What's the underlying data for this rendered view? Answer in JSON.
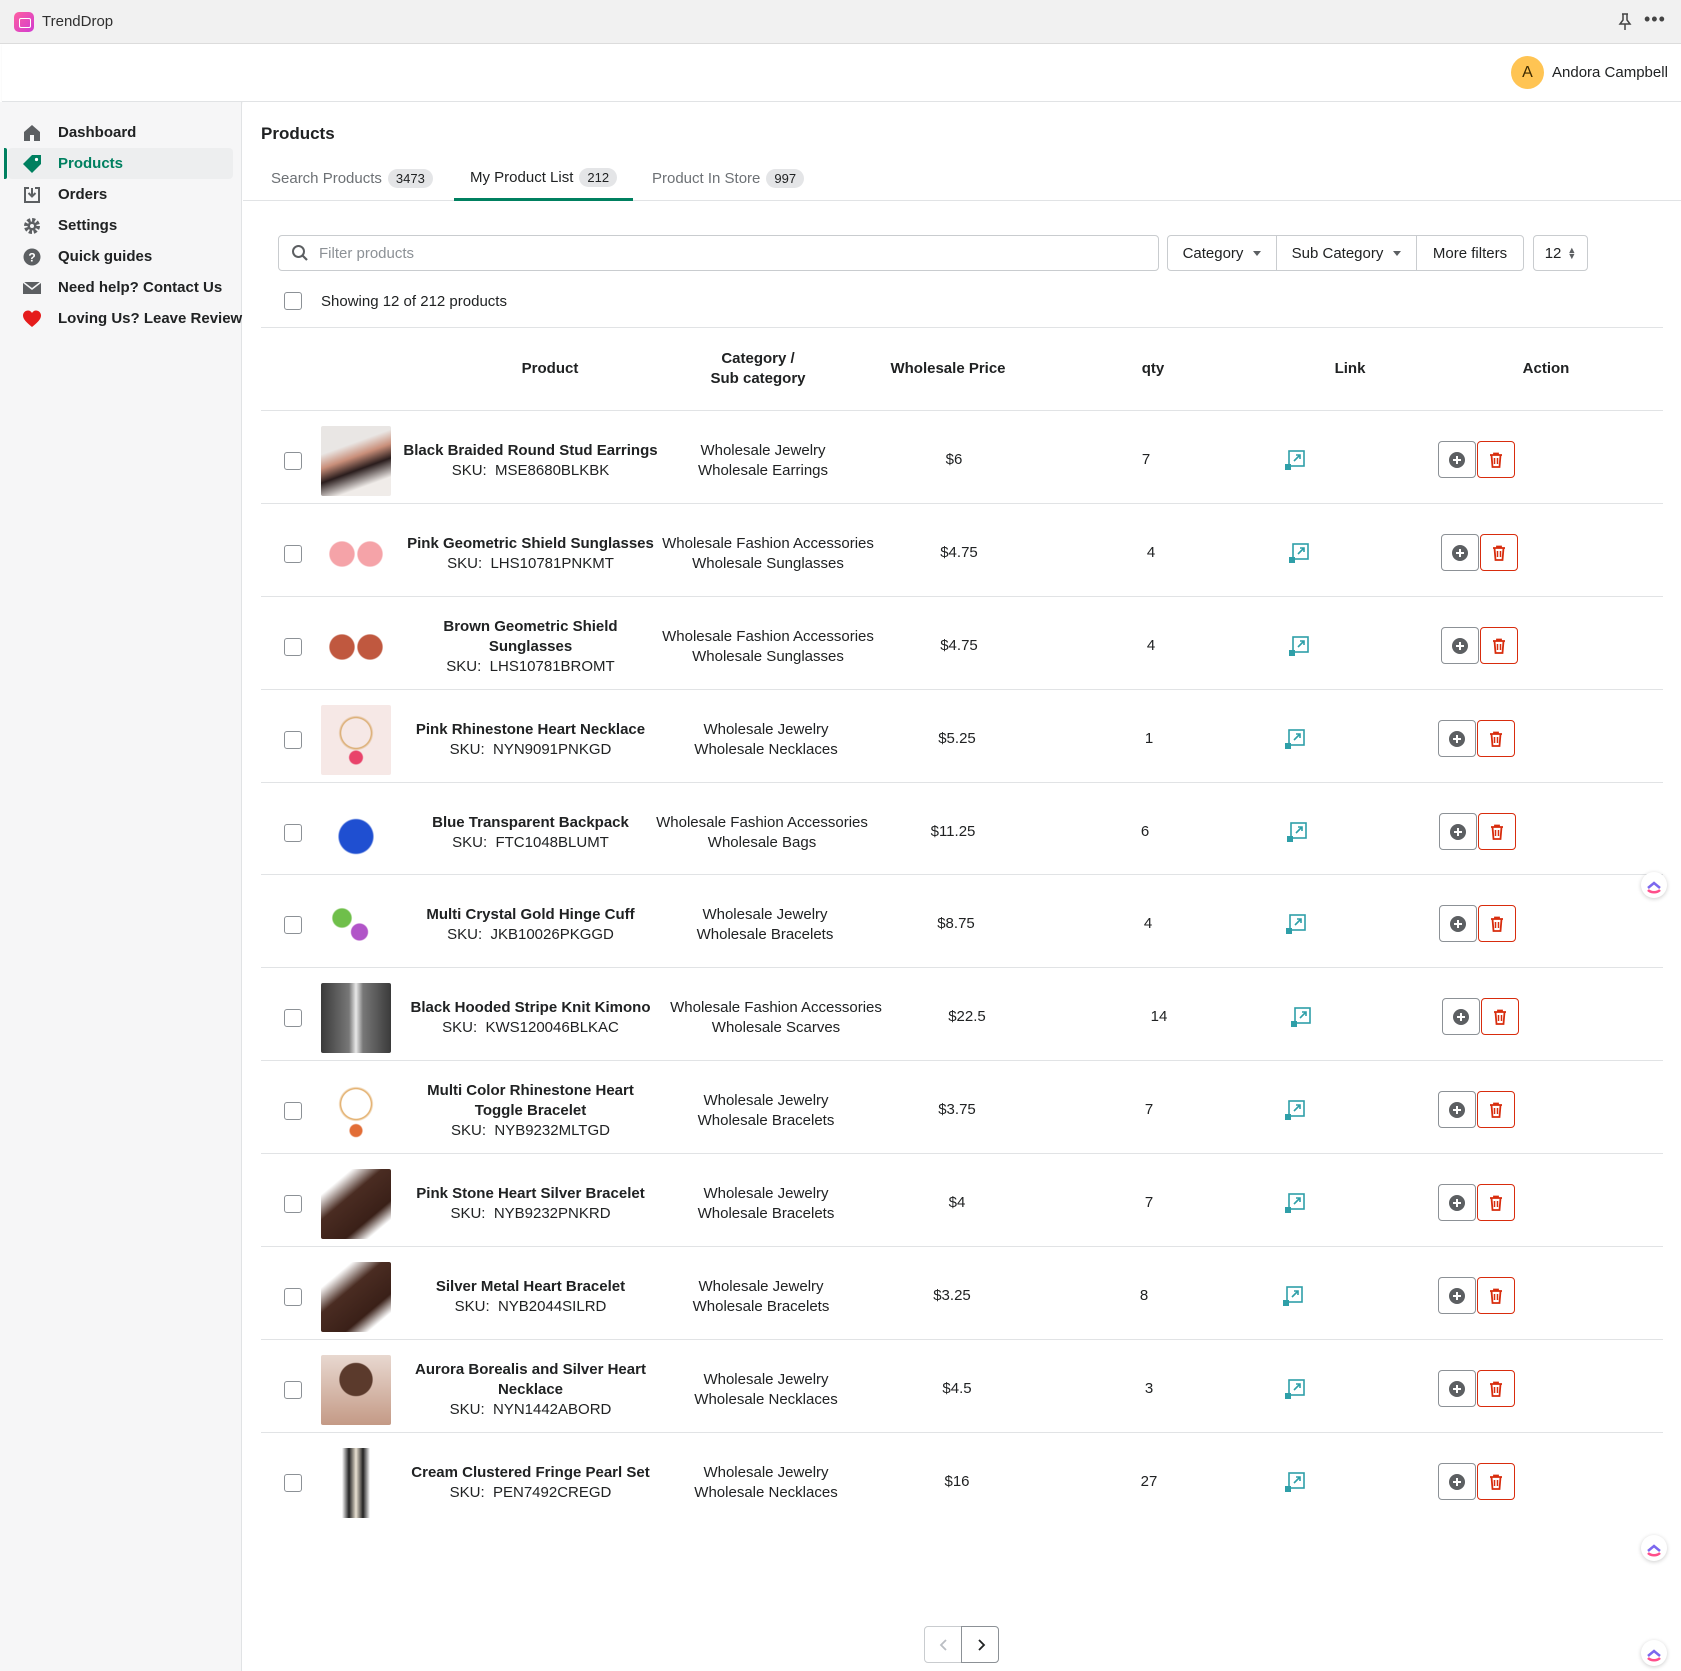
{
  "app": {
    "title": "TrendDrop"
  },
  "user": {
    "initial": "A",
    "name": "Andora Campbell"
  },
  "sidebar": {
    "items": [
      {
        "label": "Dashboard",
        "icon": "home-icon"
      },
      {
        "label": "Products",
        "icon": "tag-icon",
        "active": true
      },
      {
        "label": "Orders",
        "icon": "download-icon"
      },
      {
        "label": "Settings",
        "icon": "gear-icon"
      },
      {
        "label": "Quick guides",
        "icon": "question-icon"
      },
      {
        "label": "Need help? Contact Us",
        "icon": "mail-icon"
      },
      {
        "label": "Loving Us? Leave Review",
        "icon": "heart-icon"
      }
    ]
  },
  "page": {
    "title": "Products"
  },
  "tabs": [
    {
      "label": "Search Products",
      "count": "3473"
    },
    {
      "label": "My Product List",
      "count": "212",
      "active": true
    },
    {
      "label": "Product In Store",
      "count": "997"
    }
  ],
  "filters": {
    "search_placeholder": "Filter products",
    "category": "Category",
    "sub_category": "Sub Category",
    "more": "More filters",
    "per_page": "12"
  },
  "showing": "Showing 12 of 212 products",
  "table": {
    "headers": {
      "product": "Product",
      "category_line1": "Category /",
      "category_line2": "Sub category",
      "price": "Wholesale Price",
      "qty": "qty",
      "link": "Link",
      "action": "Action"
    },
    "sku_prefix": "SKU:",
    "rows": [
      {
        "name": "Black Braided Round Stud Earrings",
        "sku": "MSE8680BLKBK",
        "category": "Wholesale Jewelry",
        "subcategory": "Wholesale Earrings",
        "price": "$6",
        "qty": "7"
      },
      {
        "name": "Pink Geometric Shield Sunglasses",
        "sku": "LHS10781PNKMT",
        "category": "Wholesale Fashion Accessories",
        "subcategory": "Wholesale Sunglasses",
        "price": "$4.75",
        "qty": "4"
      },
      {
        "name": "Brown Geometric Shield Sunglasses",
        "sku": "LHS10781BROMT",
        "category": "Wholesale Fashion Accessories",
        "subcategory": "Wholesale Sunglasses",
        "price": "$4.75",
        "qty": "4"
      },
      {
        "name": "Pink Rhinestone Heart Necklace",
        "sku": "NYN9091PNKGD",
        "category": "Wholesale Jewelry",
        "subcategory": "Wholesale Necklaces",
        "price": "$5.25",
        "qty": "1"
      },
      {
        "name": "Blue Transparent Backpack",
        "sku": "FTC1048BLUMT",
        "category": "Wholesale Fashion Accessories",
        "subcategory": "Wholesale Bags",
        "price": "$11.25",
        "qty": "6"
      },
      {
        "name": "Multi Crystal Gold Hinge Cuff",
        "sku": "JKB10026PKGGD",
        "category": "Wholesale Jewelry",
        "subcategory": "Wholesale Bracelets",
        "price": "$8.75",
        "qty": "4"
      },
      {
        "name": "Black Hooded Stripe Knit Kimono",
        "sku": "KWS120046BLKAC",
        "category": "Wholesale Fashion Accessories",
        "subcategory": "Wholesale Scarves",
        "price": "$22.5",
        "qty": "14"
      },
      {
        "name": "Multi Color Rhinestone Heart Toggle Bracelet",
        "sku": "NYB9232MLTGD",
        "category": "Wholesale Jewelry",
        "subcategory": "Wholesale Bracelets",
        "price": "$3.75",
        "qty": "7"
      },
      {
        "name": "Pink Stone Heart Silver Bracelet",
        "sku": "NYB9232PNKRD",
        "category": "Wholesale Jewelry",
        "subcategory": "Wholesale Bracelets",
        "price": "$4",
        "qty": "7"
      },
      {
        "name": "Silver Metal Heart Bracelet",
        "sku": "NYB2044SILRD",
        "category": "Wholesale Jewelry",
        "subcategory": "Wholesale Bracelets",
        "price": "$3.25",
        "qty": "8"
      },
      {
        "name": "Aurora Borealis and Silver Heart Necklace",
        "sku": "NYN1442ABORD",
        "category": "Wholesale Jewelry",
        "subcategory": "Wholesale Necklaces",
        "price": "$4.5",
        "qty": "3"
      },
      {
        "name": "Cream Clustered Fringe Pearl Set",
        "sku": "PEN7492CREGD",
        "category": "Wholesale Jewelry",
        "subcategory": "Wholesale Necklaces",
        "price": "$16",
        "qty": "27"
      }
    ]
  },
  "colors": {
    "accent": "#008060",
    "link": "#2e9fa8",
    "danger": "#d82c0d"
  }
}
